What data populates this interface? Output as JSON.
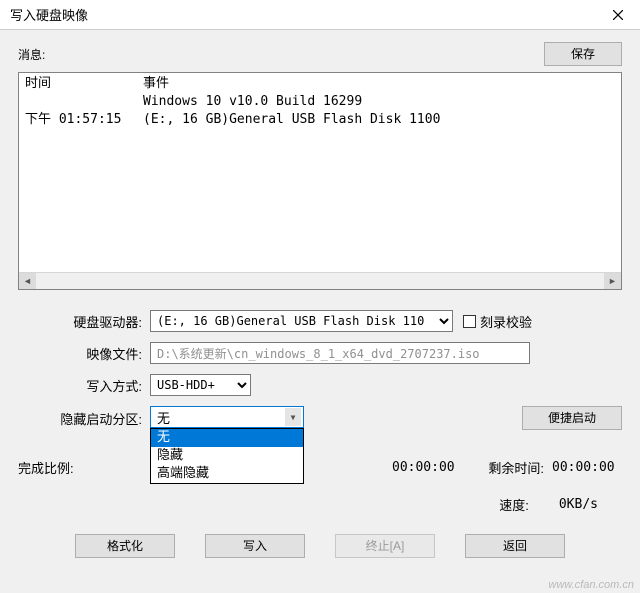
{
  "window": {
    "title": "写入硬盘映像"
  },
  "message": {
    "label": "消息:",
    "save_btn": "保存"
  },
  "log": {
    "headers": {
      "time": "时间",
      "event": "事件"
    },
    "line1_event": "Windows 10 v10.0 Build 16299",
    "line2_time": "下午 01:57:15",
    "line2_event": "(E:, 16 GB)General USB Flash Disk  1100"
  },
  "fields": {
    "drive_label": "硬盘驱动器:",
    "drive_value": "(E:, 16 GB)General USB Flash Disk  110",
    "verify_label": "刻录校验",
    "image_label": "映像文件:",
    "image_value": "D:\\系统更新\\cn_windows_8_1_x64_dvd_2707237.iso",
    "write_method_label": "写入方式:",
    "write_method_value": "USB-HDD+",
    "hide_boot_label": "隐藏启动分区:",
    "hide_boot_value": "无",
    "hide_boot_options": [
      "无",
      "隐藏",
      "高端隐藏"
    ],
    "quick_boot_btn": "便捷启动"
  },
  "progress": {
    "done_label": "完成比例:",
    "elapsed_value": "00:00:00",
    "remain_label": "剩余时间:",
    "remain_value": "00:00:00",
    "speed_label": "速度:",
    "speed_value": "0KB/s"
  },
  "actions": {
    "format": "格式化",
    "write": "写入",
    "abort": "终止[A]",
    "back": "返回"
  },
  "watermark": "www.cfan.com.cn"
}
